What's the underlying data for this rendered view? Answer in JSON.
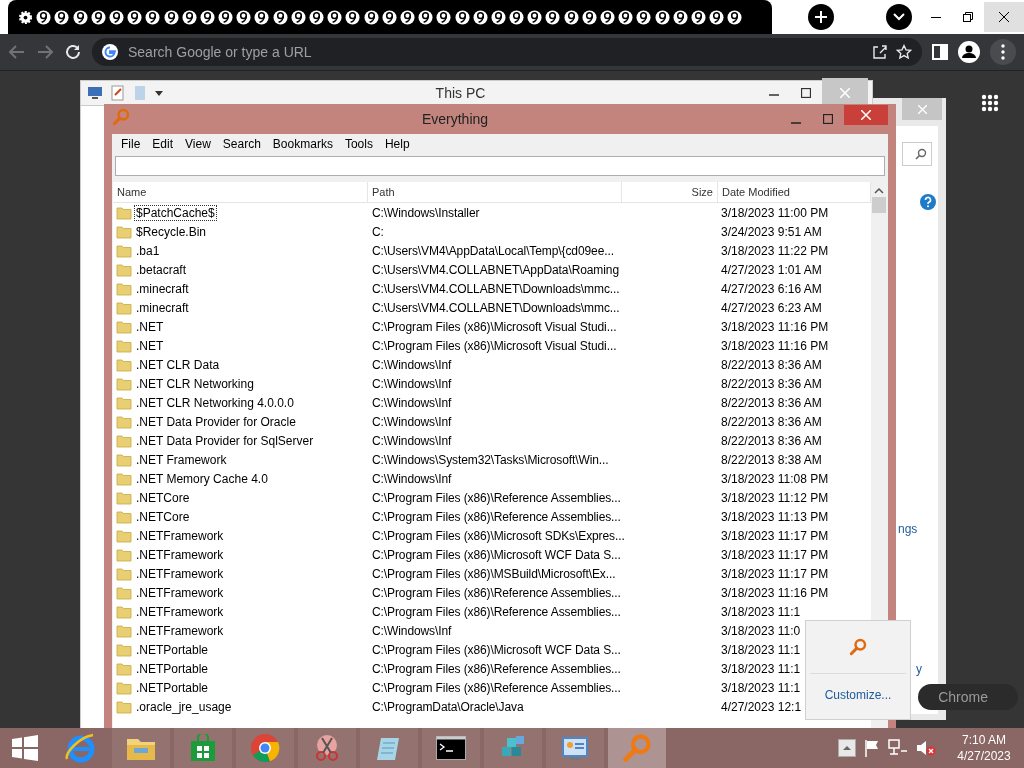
{
  "browser": {
    "omnibox": {
      "placeholder": "Search Google or type a URL"
    }
  },
  "background_window": {
    "title": "This PC"
  },
  "side_window": {
    "link_fragment": "ngs",
    "text_fragment": "y"
  },
  "chrome_pill": {
    "label": "Chrome"
  },
  "everything": {
    "title": "Everything",
    "menu": [
      "File",
      "Edit",
      "View",
      "Search",
      "Bookmarks",
      "Tools",
      "Help"
    ],
    "columns": [
      "Name",
      "Path",
      "Size",
      "Date Modified"
    ],
    "rows": [
      {
        "name": "$PatchCache$",
        "path": "C:\\Windows\\Installer",
        "date": "3/18/2023 11:00 PM",
        "focused": true
      },
      {
        "name": "$Recycle.Bin",
        "path": "C:",
        "date": "3/24/2023 9:51 AM",
        "focused": false
      },
      {
        "name": ".ba1",
        "path": "C:\\Users\\VM4\\AppData\\Local\\Temp\\{cd09ee...",
        "date": "3/18/2023 11:22 PM",
        "focused": false
      },
      {
        "name": ".betacraft",
        "path": "C:\\Users\\VM4.COLLABNET\\AppData\\Roaming",
        "date": "4/27/2023 1:01 AM",
        "focused": false
      },
      {
        "name": ".minecraft",
        "path": "C:\\Users\\VM4.COLLABNET\\Downloads\\mmc...",
        "date": "4/27/2023 6:16 AM",
        "focused": false
      },
      {
        "name": ".minecraft",
        "path": "C:\\Users\\VM4.COLLABNET\\Downloads\\mmc...",
        "date": "4/27/2023 6:23 AM",
        "focused": false
      },
      {
        "name": ".NET",
        "path": "C:\\Program Files (x86)\\Microsoft Visual Studi...",
        "date": "3/18/2023 11:16 PM",
        "focused": false
      },
      {
        "name": ".NET",
        "path": "C:\\Program Files (x86)\\Microsoft Visual Studi...",
        "date": "3/18/2023 11:16 PM",
        "focused": false
      },
      {
        "name": ".NET CLR Data",
        "path": "C:\\Windows\\Inf",
        "date": "8/22/2013 8:36 AM",
        "focused": false
      },
      {
        "name": ".NET CLR Networking",
        "path": "C:\\Windows\\Inf",
        "date": "8/22/2013 8:36 AM",
        "focused": false
      },
      {
        "name": ".NET CLR Networking 4.0.0.0",
        "path": "C:\\Windows\\Inf",
        "date": "8/22/2013 8:36 AM",
        "focused": false
      },
      {
        "name": ".NET Data Provider for Oracle",
        "path": "C:\\Windows\\Inf",
        "date": "8/22/2013 8:36 AM",
        "focused": false
      },
      {
        "name": ".NET Data Provider for SqlServer",
        "path": "C:\\Windows\\Inf",
        "date": "8/22/2013 8:36 AM",
        "focused": false
      },
      {
        "name": ".NET Framework",
        "path": "C:\\Windows\\System32\\Tasks\\Microsoft\\Win...",
        "date": "8/22/2013 8:38 AM",
        "focused": false
      },
      {
        "name": ".NET Memory Cache 4.0",
        "path": "C:\\Windows\\Inf",
        "date": "3/18/2023 11:08 PM",
        "focused": false
      },
      {
        "name": ".NETCore",
        "path": "C:\\Program Files (x86)\\Reference Assemblies...",
        "date": "3/18/2023 11:12 PM",
        "focused": false
      },
      {
        "name": ".NETCore",
        "path": "C:\\Program Files (x86)\\Reference Assemblies...",
        "date": "3/18/2023 11:13 PM",
        "focused": false
      },
      {
        "name": ".NETFramework",
        "path": "C:\\Program Files (x86)\\Microsoft SDKs\\Expres...",
        "date": "3/18/2023 11:17 PM",
        "focused": false
      },
      {
        "name": ".NETFramework",
        "path": "C:\\Program Files (x86)\\Microsoft WCF Data S...",
        "date": "3/18/2023 11:17 PM",
        "focused": false
      },
      {
        "name": ".NETFramework",
        "path": "C:\\Program Files (x86)\\MSBuild\\Microsoft\\Ex...",
        "date": "3/18/2023 11:17 PM",
        "focused": false
      },
      {
        "name": ".NETFramework",
        "path": "C:\\Program Files (x86)\\Reference Assemblies...",
        "date": "3/18/2023 11:16 PM",
        "focused": false
      },
      {
        "name": ".NETFramework",
        "path": "C:\\Program Files (x86)\\Reference Assemblies...",
        "date": "3/18/2023 11:1",
        "focused": false
      },
      {
        "name": ".NETFramework",
        "path": "C:\\Windows\\Inf",
        "date": "3/18/2023 11:0",
        "focused": false
      },
      {
        "name": ".NETPortable",
        "path": "C:\\Program Files (x86)\\Microsoft WCF Data S...",
        "date": "3/18/2023 11:1",
        "focused": false
      },
      {
        "name": ".NETPortable",
        "path": "C:\\Program Files (x86)\\Reference Assemblies...",
        "date": "3/18/2023 11:1",
        "focused": false
      },
      {
        "name": ".NETPortable",
        "path": "C:\\Program Files (x86)\\Reference Assemblies...",
        "date": "3/18/2023 11:1",
        "focused": false
      },
      {
        "name": ".oracle_jre_usage",
        "path": "C:\\ProgramData\\Oracle\\Java",
        "date": "4/27/2023 12:1",
        "focused": false
      }
    ]
  },
  "popup": {
    "action": "Customize..."
  },
  "taskbar": {
    "apps": [
      {
        "kind": "explorer",
        "active": false
      },
      {
        "kind": "store",
        "active": false
      },
      {
        "kind": "chrome",
        "active": false
      },
      {
        "kind": "snip",
        "active": false
      },
      {
        "kind": "notepad",
        "active": false
      },
      {
        "kind": "cmd",
        "active": false
      },
      {
        "kind": "regedit",
        "active": false
      },
      {
        "kind": "panel",
        "active": false
      },
      {
        "kind": "everything",
        "active": true
      }
    ],
    "clock": {
      "time": "7:10 AM",
      "date": "4/27/2023"
    }
  }
}
